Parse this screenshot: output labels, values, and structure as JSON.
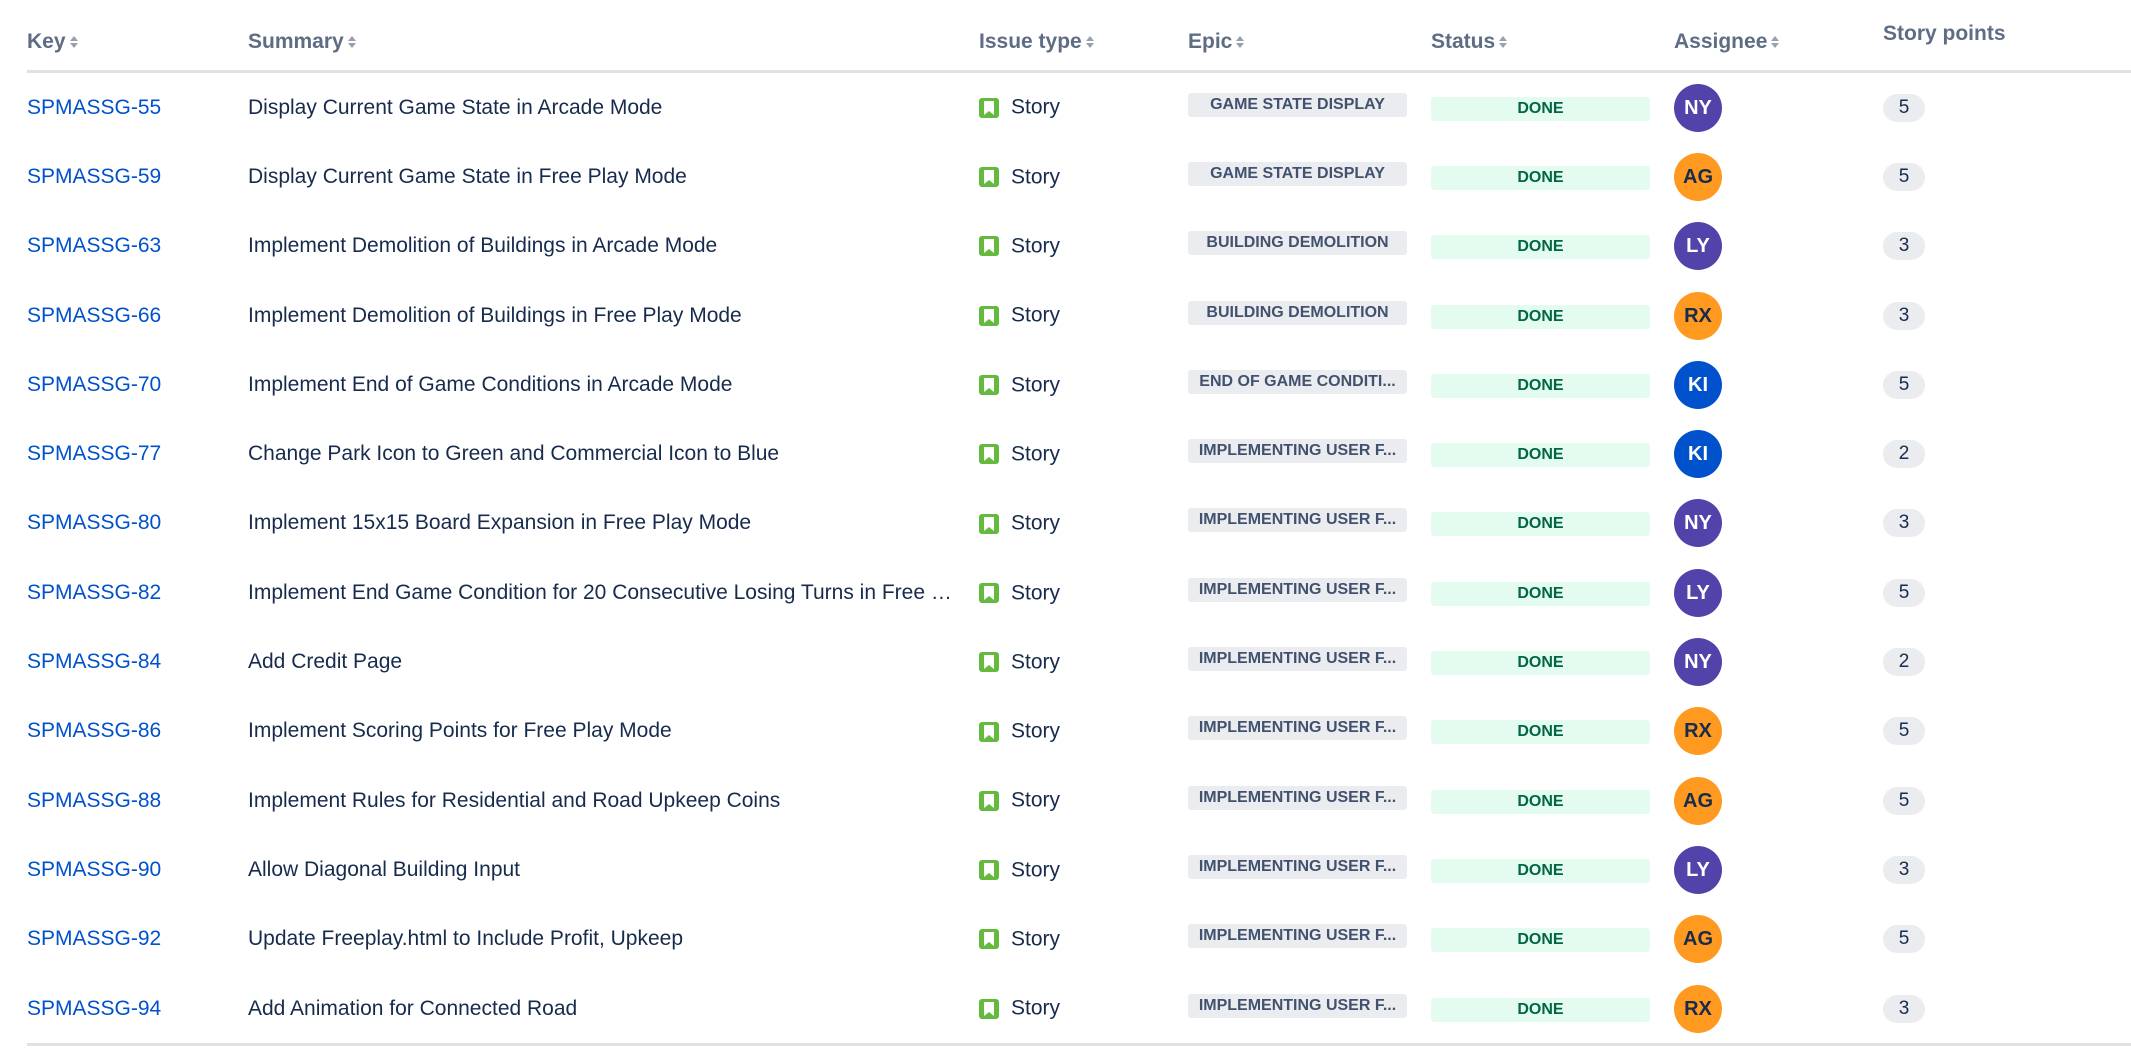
{
  "columns": {
    "key": "Key",
    "summary": "Summary",
    "issue_type": "Issue type",
    "epic": "Epic",
    "status": "Status",
    "assignee": "Assignee",
    "story_points": "Story points"
  },
  "colors": {
    "link": "#0052cc",
    "story_icon": "#63ba3c",
    "status_done_bg": "#e3fcef",
    "status_done_text": "#006644",
    "avatar_purple": "#5243aa",
    "avatar_orange": "#ff991f",
    "avatar_blue": "#0052cc"
  },
  "rows": [
    {
      "key": "SPMASSG-55",
      "summary": "Display Current Game State in Arcade Mode",
      "type": "Story",
      "epic": "GAME STATE DISPLAY",
      "status": "DONE",
      "assignee": "NY",
      "avatar_color": "#5243aa",
      "avatar_text": "#ffffff",
      "points": "5"
    },
    {
      "key": "SPMASSG-59",
      "summary": "Display Current Game State in Free Play Mode",
      "type": "Story",
      "epic": "GAME STATE DISPLAY",
      "status": "DONE",
      "assignee": "AG",
      "avatar_color": "#ff991f",
      "avatar_text": "#172b4d",
      "points": "5"
    },
    {
      "key": "SPMASSG-63",
      "summary": "Implement Demolition of Buildings in Arcade Mode",
      "type": "Story",
      "epic": "BUILDING DEMOLITION",
      "status": "DONE",
      "assignee": "LY",
      "avatar_color": "#5243aa",
      "avatar_text": "#ffffff",
      "points": "3"
    },
    {
      "key": "SPMASSG-66",
      "summary": "Implement Demolition of Buildings in Free Play Mode",
      "type": "Story",
      "epic": "BUILDING DEMOLITION",
      "status": "DONE",
      "assignee": "RX",
      "avatar_color": "#ff991f",
      "avatar_text": "#172b4d",
      "points": "3"
    },
    {
      "key": "SPMASSG-70",
      "summary": "Implement End of Game Conditions in Arcade Mode",
      "type": "Story",
      "epic": "END OF GAME CONDITI...",
      "status": "DONE",
      "assignee": "KI",
      "avatar_color": "#0052cc",
      "avatar_text": "#ffffff",
      "points": "5"
    },
    {
      "key": "SPMASSG-77",
      "summary": "Change Park Icon to Green and Commercial Icon to Blue",
      "type": "Story",
      "epic": "IMPLEMENTING USER F...",
      "status": "DONE",
      "assignee": "KI",
      "avatar_color": "#0052cc",
      "avatar_text": "#ffffff",
      "points": "2"
    },
    {
      "key": "SPMASSG-80",
      "summary": "Implement 15x15 Board Expansion in Free Play Mode",
      "type": "Story",
      "epic": "IMPLEMENTING USER F...",
      "status": "DONE",
      "assignee": "NY",
      "avatar_color": "#5243aa",
      "avatar_text": "#ffffff",
      "points": "3"
    },
    {
      "key": "SPMASSG-82",
      "summary": "Implement End Game Condition for 20 Consecutive Losing Turns in Free P...",
      "type": "Story",
      "epic": "IMPLEMENTING USER F...",
      "status": "DONE",
      "assignee": "LY",
      "avatar_color": "#5243aa",
      "avatar_text": "#ffffff",
      "points": "5"
    },
    {
      "key": "SPMASSG-84",
      "summary": "Add Credit Page",
      "type": "Story",
      "epic": "IMPLEMENTING USER F...",
      "status": "DONE",
      "assignee": "NY",
      "avatar_color": "#5243aa",
      "avatar_text": "#ffffff",
      "points": "2"
    },
    {
      "key": "SPMASSG-86",
      "summary": "Implement Scoring Points for Free Play Mode",
      "type": "Story",
      "epic": "IMPLEMENTING USER F...",
      "status": "DONE",
      "assignee": "RX",
      "avatar_color": "#ff991f",
      "avatar_text": "#172b4d",
      "points": "5"
    },
    {
      "key": "SPMASSG-88",
      "summary": "Implement Rules for Residential and Road Upkeep Coins",
      "type": "Story",
      "epic": "IMPLEMENTING USER F...",
      "status": "DONE",
      "assignee": "AG",
      "avatar_color": "#ff991f",
      "avatar_text": "#172b4d",
      "points": "5"
    },
    {
      "key": "SPMASSG-90",
      "summary": "Allow Diagonal Building Input",
      "type": "Story",
      "epic": "IMPLEMENTING USER F...",
      "status": "DONE",
      "assignee": "LY",
      "avatar_color": "#5243aa",
      "avatar_text": "#ffffff",
      "points": "3"
    },
    {
      "key": "SPMASSG-92",
      "summary": "Update Freeplay.html to Include Profit, Upkeep",
      "type": "Story",
      "epic": "IMPLEMENTING USER F...",
      "status": "DONE",
      "assignee": "AG",
      "avatar_color": "#ff991f",
      "avatar_text": "#172b4d",
      "points": "5"
    },
    {
      "key": "SPMASSG-94",
      "summary": "Add Animation for Connected Road",
      "type": "Story",
      "epic": "IMPLEMENTING USER F...",
      "status": "DONE",
      "assignee": "RX",
      "avatar_color": "#ff991f",
      "avatar_text": "#172b4d",
      "points": "3"
    }
  ]
}
